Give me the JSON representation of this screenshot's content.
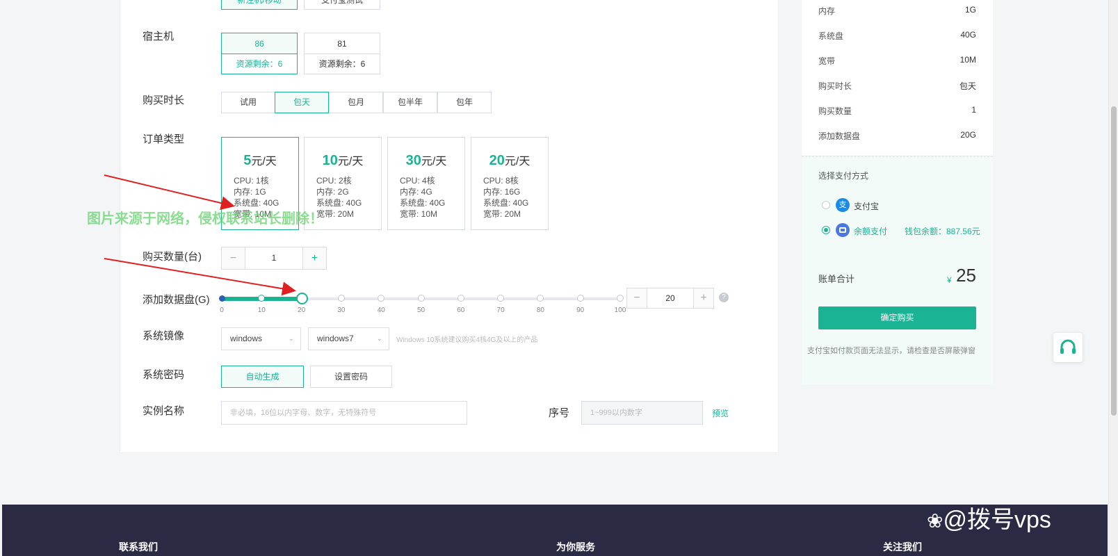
{
  "top_tabs": [
    "新注机/移动",
    "支付宝测试"
  ],
  "form": {
    "host": {
      "label": "宿主机",
      "cards": [
        {
          "num": "86",
          "remain": "资源剩余：6"
        },
        {
          "num": "81",
          "remain": "资源剩余：6"
        }
      ]
    },
    "duration": {
      "label": "购买时长",
      "options": [
        "试用",
        "包天",
        "包月",
        "包半年",
        "包年"
      ],
      "selected": "包天"
    },
    "order_type": {
      "label": "订单类型",
      "plans": [
        {
          "price": "5",
          "unit": "元/天",
          "cpu": "CPU: 1核",
          "mem": "内存: 1G",
          "disk": "系统盘: 40G",
          "bw": "宽带: 10M"
        },
        {
          "price": "10",
          "unit": "元/天",
          "cpu": "CPU: 2核",
          "mem": "内存: 2G",
          "disk": "系统盘: 40G",
          "bw": "宽带: 20M"
        },
        {
          "price": "30",
          "unit": "元/天",
          "cpu": "CPU: 4核",
          "mem": "内存: 4G",
          "disk": "系统盘: 40G",
          "bw": "宽带: 10M"
        },
        {
          "price": "20",
          "unit": "元/天",
          "cpu": "CPU: 8核",
          "mem": "内存: 16G",
          "disk": "系统盘: 40G",
          "bw": "宽带: 20M"
        }
      ]
    },
    "quantity": {
      "label": "购买数量(台)",
      "minus": "−",
      "value": "1",
      "plus": "+"
    },
    "data_disk": {
      "label": "添加数据盘(G)",
      "ticks": [
        "0",
        "10",
        "20",
        "30",
        "40",
        "50",
        "60",
        "70",
        "80",
        "90",
        "100"
      ],
      "value": 20,
      "max": 100,
      "minus": "−",
      "input": "20",
      "plus": "+",
      "help": "?"
    },
    "image": {
      "label": "系统镜像",
      "os": "windows",
      "version": "windows7",
      "hint": "Windows 10系统建议购买4核4G及以上的产品"
    },
    "password": {
      "label": "系统密码",
      "auto": "自动生成",
      "set": "设置密码"
    },
    "instance": {
      "label": "实例名称",
      "placeholder": "非必填，16位以内字母、数字，无特殊符号",
      "seq_label": "序号",
      "seq_placeholder": "1~999以内数字",
      "preview": "预览"
    }
  },
  "summary": {
    "rows": [
      {
        "k": "内存",
        "v": "1G"
      },
      {
        "k": "系统盘",
        "v": "40G"
      },
      {
        "k": "宽带",
        "v": "10M"
      },
      {
        "k": "购买时长",
        "v": "包天"
      },
      {
        "k": "购买数量",
        "v": "1"
      },
      {
        "k": "添加数据盘",
        "v": "20G"
      }
    ]
  },
  "payment": {
    "title": "选择支付方式",
    "alipay": "支付宝",
    "balance": "余额支付",
    "wallet": "钱包余额：887.56元",
    "total_label": "账单合计",
    "currency": "¥",
    "total": "25",
    "confirm": "确定购买",
    "note": "支付宝如付款页面无法显示，请检查是否屏蔽弹窗"
  },
  "watermark": "图片来源于网络，侵权联系站长删除！",
  "footer": {
    "contact": "联系我们",
    "service": "为你服务",
    "follow": "关注我们",
    "brand": "@拨号vps"
  },
  "colors": {
    "accent": "#1ab394",
    "arrow": "#e02020",
    "footer": "#2a2a45"
  }
}
